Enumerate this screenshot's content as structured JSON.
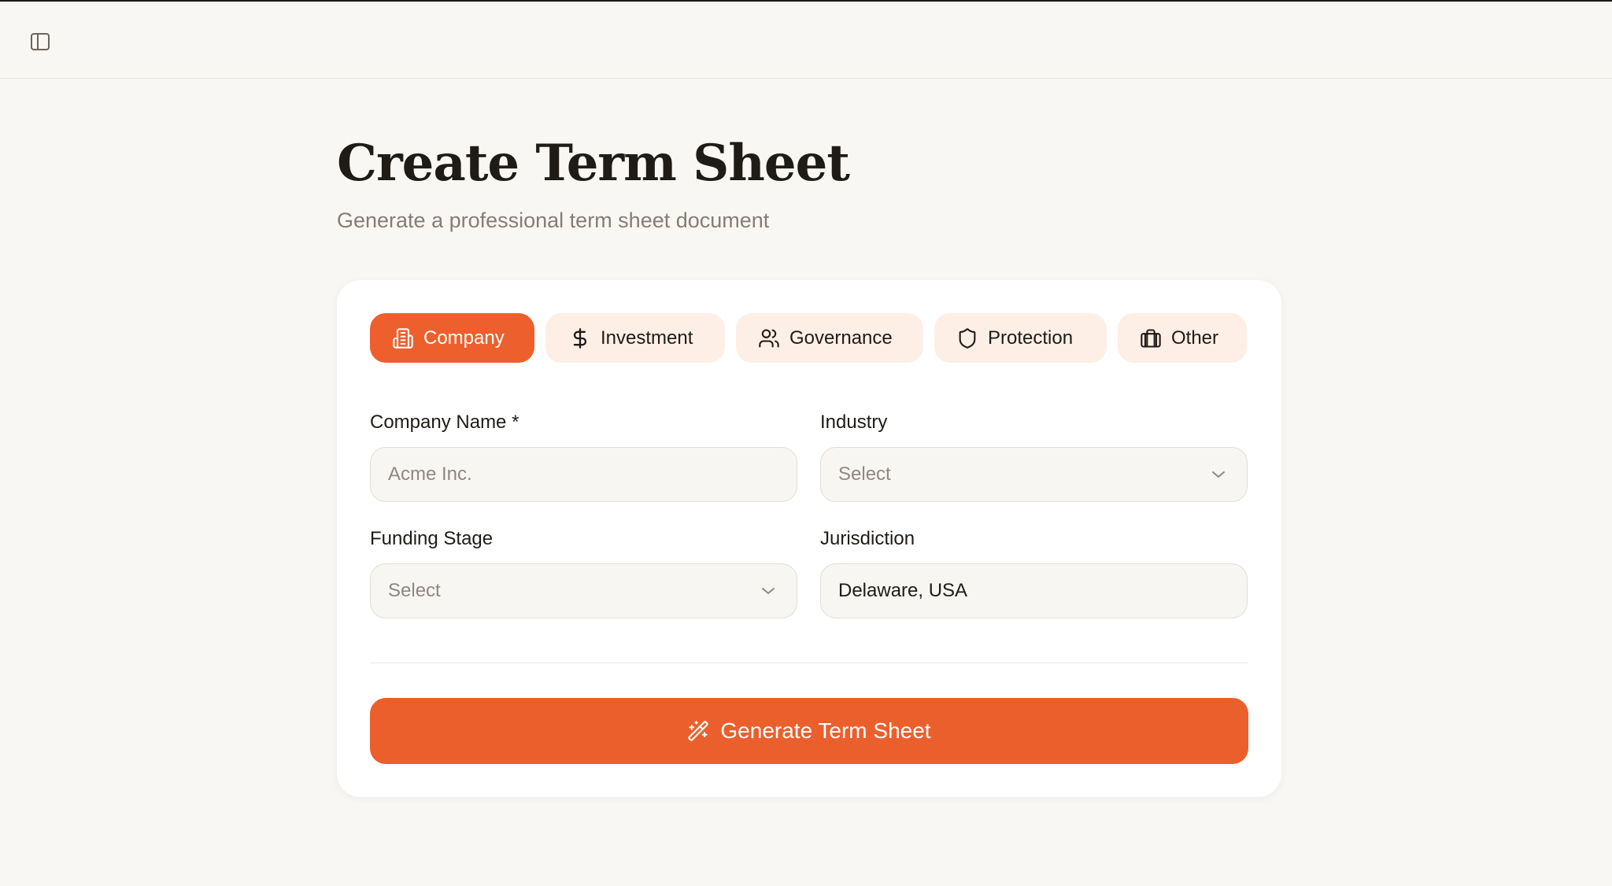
{
  "header": {
    "sidebar_toggle_icon": "sidebar-panel-icon"
  },
  "page": {
    "title": "Create Term Sheet",
    "subtitle": "Generate a professional term sheet document"
  },
  "tabs": [
    {
      "label": "Company",
      "icon": "building-icon",
      "active": true
    },
    {
      "label": "Investment",
      "icon": "dollar-icon",
      "active": false
    },
    {
      "label": "Governance",
      "icon": "users-icon",
      "active": false
    },
    {
      "label": "Protection",
      "icon": "shield-icon",
      "active": false
    },
    {
      "label": "Other",
      "icon": "briefcase-icon",
      "active": false
    }
  ],
  "form": {
    "company_name": {
      "label": "Company Name *",
      "placeholder": "Acme Inc.",
      "value": ""
    },
    "industry": {
      "label": "Industry",
      "value": "Select"
    },
    "funding_stage": {
      "label": "Funding Stage",
      "value": "Select"
    },
    "jurisdiction": {
      "label": "Jurisdiction",
      "value": "Delaware, USA"
    }
  },
  "actions": {
    "generate_label": "Generate Term Sheet",
    "generate_icon": "magic-wand-icon"
  },
  "colors": {
    "accent": "#EB5F2D",
    "tab_inactive_bg": "#FDEFE6",
    "page_bg": "#F9F7F3",
    "card_bg": "#FFFFFF"
  }
}
